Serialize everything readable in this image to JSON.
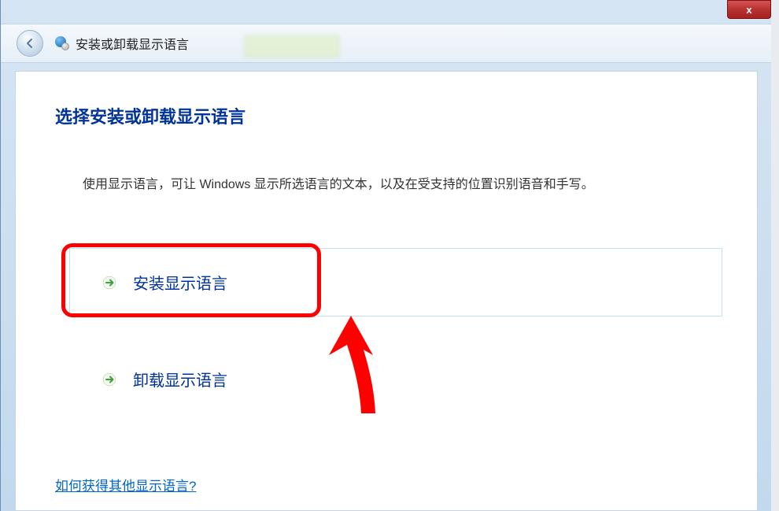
{
  "window": {
    "close_label": "x",
    "header_title": "安装或卸载显示语言"
  },
  "page": {
    "title": "选择安装或卸载显示语言",
    "description": "使用显示语言，可让 Windows 显示所选语言的文本，以及在受支持的位置识别语音和手写。"
  },
  "options": {
    "install": "安装显示语言",
    "uninstall": "卸载显示语言"
  },
  "help": {
    "link_text": "如何获得其他显示语言?"
  }
}
